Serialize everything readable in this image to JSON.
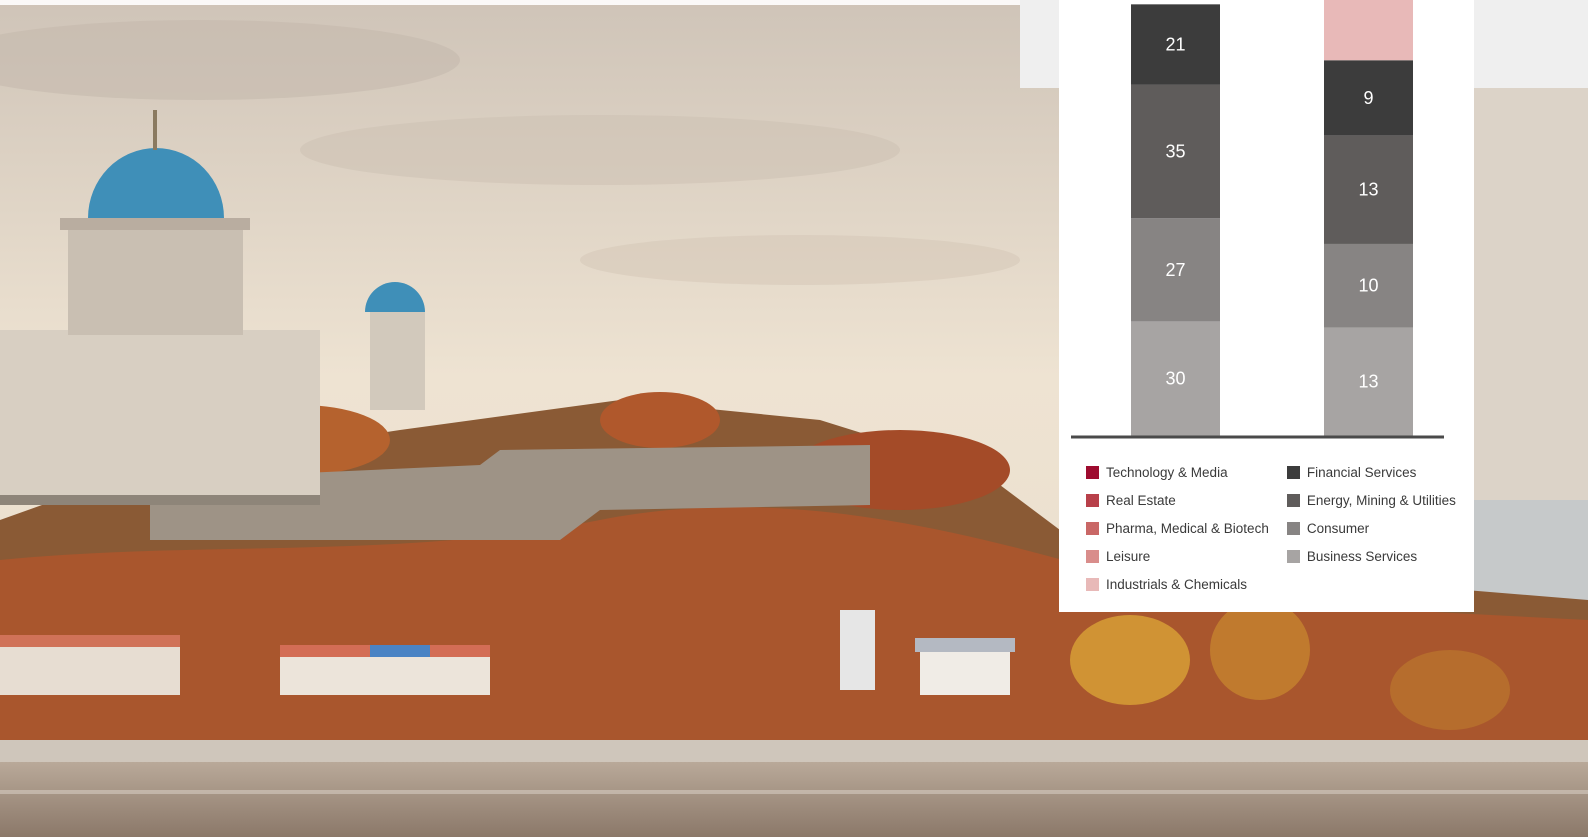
{
  "colors": {
    "technology_media": "#9e0b2f",
    "real_estate": "#b8404a",
    "pharma": "#c96766",
    "leisure": "#d98d8b",
    "industrials": "#e8b9b8",
    "financial": "#3c3c3c",
    "energy": "#5f5c5b",
    "consumer": "#878483",
    "business": "#a7a4a3"
  },
  "chart_data": {
    "type": "bar",
    "stacked": true,
    "categories": [
      "",
      ""
    ],
    "series": [
      {
        "name": "Business Services",
        "key": "business",
        "values": [
          30,
          13
        ]
      },
      {
        "name": "Consumer",
        "key": "consumer",
        "values": [
          27,
          10
        ]
      },
      {
        "name": "Energy, Mining & Utilities",
        "key": "energy",
        "values": [
          35,
          13
        ]
      },
      {
        "name": "Financial Services",
        "key": "financial",
        "values": [
          21,
          9
        ]
      },
      {
        "name": "Industrials & Chemicals",
        "key": "industrials",
        "values": [
          null,
          null
        ]
      },
      {
        "name": "Leisure",
        "key": "leisure",
        "values": [
          null,
          null
        ]
      },
      {
        "name": "Pharma, Medical & Biotech",
        "key": "pharma",
        "values": [
          null,
          null
        ]
      },
      {
        "name": "Real Estate",
        "key": "real_estate",
        "values": [
          null,
          null
        ]
      },
      {
        "name": "Technology & Media",
        "key": "technology_media",
        "values": [
          null,
          null
        ]
      }
    ],
    "title": "",
    "xlabel": "",
    "ylabel": "",
    "grid": false,
    "legend_position": "bottom"
  },
  "legend": {
    "left": [
      {
        "label": "Technology & Media",
        "key": "technology_media"
      },
      {
        "label": "Real Estate",
        "key": "real_estate"
      },
      {
        "label": "Pharma, Medical & Biotech",
        "key": "pharma"
      },
      {
        "label": "Leisure",
        "key": "leisure"
      },
      {
        "label": "Industrials & Chemicals",
        "key": "industrials"
      }
    ],
    "right": [
      {
        "label": "Financial Services",
        "key": "financial"
      },
      {
        "label": "Energy, Mining & Utilities",
        "key": "energy"
      },
      {
        "label": "Consumer",
        "key": "consumer"
      },
      {
        "label": "Business Services",
        "key": "business"
      }
    ]
  }
}
